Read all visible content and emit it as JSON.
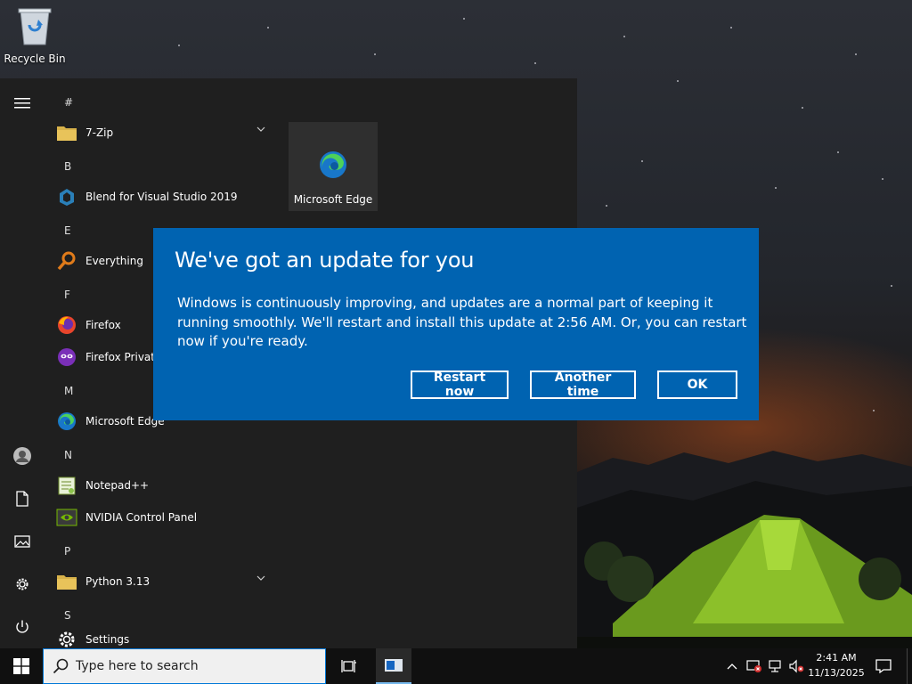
{
  "desktop": {
    "recycle_bin_label": "Recycle Bin"
  },
  "start_menu": {
    "tile_label": "Microsoft Edge",
    "groups": [
      {
        "letter": "#",
        "items": [
          {
            "label": "7-Zip",
            "icon": "folder-icon",
            "expandable": true
          }
        ]
      },
      {
        "letter": "B",
        "items": [
          {
            "label": "Blend for Visual Studio 2019",
            "icon": "blend-icon",
            "expandable": false
          }
        ]
      },
      {
        "letter": "E",
        "items": [
          {
            "label": "Everything",
            "icon": "everything-search-icon",
            "expandable": false
          }
        ]
      },
      {
        "letter": "F",
        "items": [
          {
            "label": "Firefox",
            "icon": "firefox-icon",
            "expandable": false
          },
          {
            "label": "Firefox Private Browsing",
            "icon": "firefox-private-icon",
            "expandable": false
          }
        ]
      },
      {
        "letter": "M",
        "items": [
          {
            "label": "Microsoft Edge",
            "icon": "edge-icon",
            "expandable": false
          }
        ]
      },
      {
        "letter": "N",
        "items": [
          {
            "label": "Notepad++",
            "icon": "notepadpp-icon",
            "expandable": false
          },
          {
            "label": "NVIDIA Control Panel",
            "icon": "nvidia-icon",
            "expandable": false
          }
        ]
      },
      {
        "letter": "P",
        "items": [
          {
            "label": "Python 3.13",
            "icon": "folder-icon",
            "expandable": true
          }
        ]
      },
      {
        "letter": "S",
        "items": [
          {
            "label": "Settings",
            "icon": "gear-icon",
            "expandable": false
          }
        ]
      }
    ]
  },
  "dialog": {
    "title": "We've got an update for you",
    "body": "Windows is continuously improving, and updates are a normal part of keeping it running smoothly. We'll restart and install this update at 2:56 AM. Or, you can restart now if you're ready.",
    "buttons": {
      "restart": "Restart now",
      "another": "Another time",
      "ok": "OK"
    },
    "background_color": "#0063b1"
  },
  "taskbar": {
    "search_placeholder": "Type here to search",
    "clock": {
      "time": "2:41 AM",
      "date": "11/13/2025"
    }
  }
}
